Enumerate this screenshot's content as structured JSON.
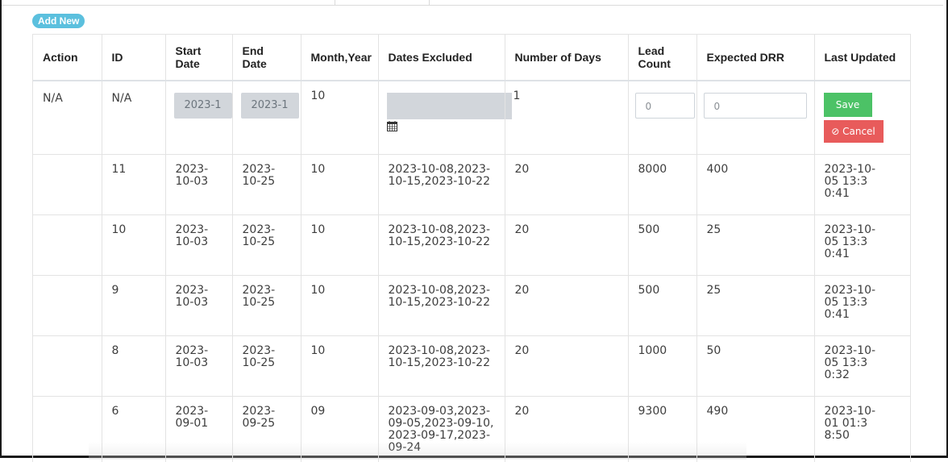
{
  "toolbar": {
    "add_new_label": "Add New"
  },
  "table": {
    "headers": {
      "action": "Action",
      "id": "ID",
      "start_date": "Start Date",
      "end_date": "End Date",
      "month_year": "Month,Year",
      "dates_excluded": "Dates Excluded",
      "number_of_days": "Number of Days",
      "lead_count": "Lead Count",
      "expected_drr": "Expected DRR",
      "last_updated": "Last Updated"
    },
    "edit_row": {
      "action": "N/A",
      "id": "N/A",
      "start_date_value": "2023-1",
      "end_date_value": "2023-1",
      "month_year": "10",
      "number_of_days": "1",
      "lead_count_placeholder": "0",
      "expected_drr_placeholder": "0",
      "save_label": "Save",
      "cancel_label": "⊘ Cancel",
      "calendar_icon": "calendar-icon"
    },
    "rows": [
      {
        "id": "11",
        "start_date": "2023-10-03",
        "end_date": "2023-10-25",
        "month_year": "10",
        "dates_excluded": "2023-10-08,2023-10-15,2023-10-22",
        "number_of_days": "20",
        "lead_count": "8000",
        "expected_drr": "400",
        "last_updated": "2023-10-05 13:30:41"
      },
      {
        "id": "10",
        "start_date": "2023-10-03",
        "end_date": "2023-10-25",
        "month_year": "10",
        "dates_excluded": "2023-10-08,2023-10-15,2023-10-22",
        "number_of_days": "20",
        "lead_count": "500",
        "expected_drr": "25",
        "last_updated": "2023-10-05 13:30:41"
      },
      {
        "id": "9",
        "start_date": "2023-10-03",
        "end_date": "2023-10-25",
        "month_year": "10",
        "dates_excluded": "2023-10-08,2023-10-15,2023-10-22",
        "number_of_days": "20",
        "lead_count": "500",
        "expected_drr": "25",
        "last_updated": "2023-10-05 13:30:41"
      },
      {
        "id": "8",
        "start_date": "2023-10-03",
        "end_date": "2023-10-25",
        "month_year": "10",
        "dates_excluded": "2023-10-08,2023-10-15,2023-10-22",
        "number_of_days": "20",
        "lead_count": "1000",
        "expected_drr": "50",
        "last_updated": "2023-10-05 13:30:32"
      },
      {
        "id": "6",
        "start_date": "2023-09-01",
        "end_date": "2023-09-25",
        "month_year": "09",
        "dates_excluded": "2023-09-03,2023-09-05,2023-09-10,2023-09-17,2023-09-24",
        "number_of_days": "20",
        "lead_count": "9300",
        "expected_drr": "490",
        "last_updated": "2023-10-01 01:38:50"
      }
    ]
  },
  "colors": {
    "add_new_bg": "#5bc0de",
    "save_bg": "#4cc266",
    "cancel_bg": "#e85b5b",
    "input_disabled_bg": "#d2d6db"
  }
}
